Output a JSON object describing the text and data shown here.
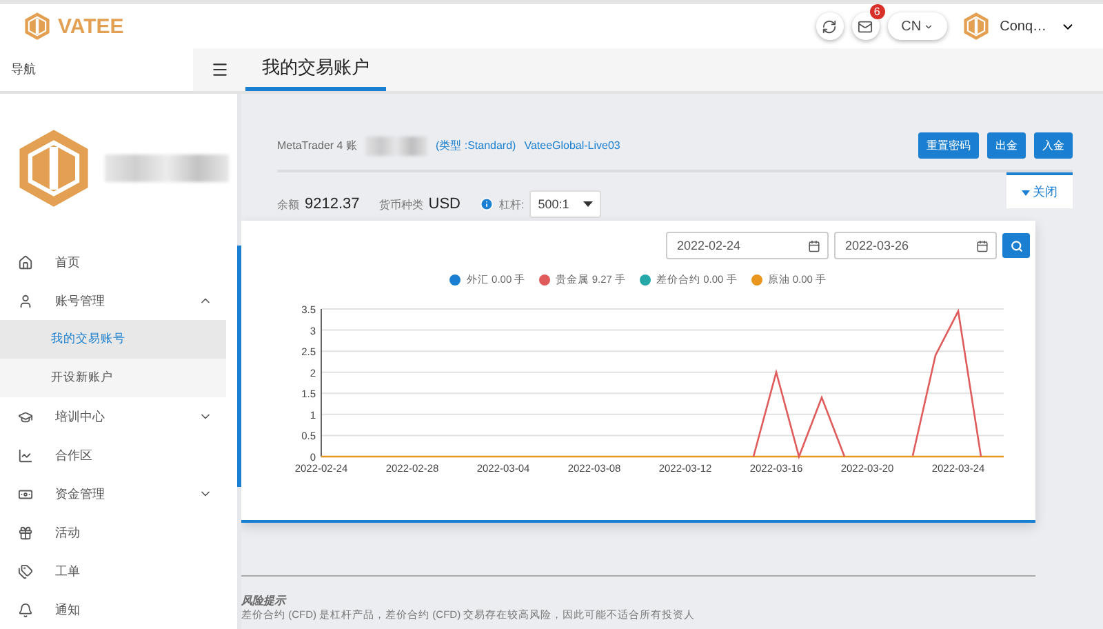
{
  "header": {
    "logo_text": "VATEE",
    "mail_badge": "6",
    "language": "CN",
    "user_name": "Conq…"
  },
  "nav": {
    "label": "导航",
    "tabs": [
      {
        "label": "我的交易账户",
        "selected": true
      }
    ]
  },
  "sidebar": {
    "items": [
      {
        "label": "首页"
      },
      {
        "label": "账号管理",
        "expanded": true,
        "children": [
          {
            "label": "我的交易账号",
            "selected": true
          },
          {
            "label": "开设新账户",
            "selected": false
          }
        ]
      },
      {
        "label": "培训中心",
        "expanded": false
      },
      {
        "label": "合作区"
      },
      {
        "label": "资金管理",
        "expanded": false
      },
      {
        "label": "活动"
      },
      {
        "label": "工单"
      },
      {
        "label": "通知"
      }
    ]
  },
  "account": {
    "platform": "MetaTrader 4 账",
    "type": "(类型 :Standard)",
    "server": "VateeGlobal-Live03",
    "buttons": [
      "重置密码",
      "出金",
      "入金"
    ]
  },
  "summary": {
    "balance_label": "余额",
    "balance": "9212.37",
    "currency_label": "货币种类",
    "currency": "USD",
    "leverage_label": "杠杆:",
    "leverage": "500:1"
  },
  "panel": {
    "toggle": "关闭",
    "date_from": "2022-02-24",
    "date_to": "2022-03-26",
    "legend": [
      {
        "label": "外汇 0.00 手",
        "color": "#1a7fd0"
      },
      {
        "label": "贵金属 9.27 手",
        "color": "#e05b5b"
      },
      {
        "label": "差价合约 0.00 手",
        "color": "#26a8a8"
      },
      {
        "label": "原油 0.00 手",
        "color": "#e8961e"
      }
    ],
    "chart_data": {
      "type": "line",
      "categories": [
        "2022-02-24",
        null,
        null,
        null,
        "2022-02-28",
        null,
        null,
        null,
        "2022-03-04",
        null,
        null,
        null,
        "2022-03-08",
        null,
        null,
        null,
        "2022-03-12",
        null,
        null,
        null,
        "2022-03-16",
        null,
        null,
        null,
        "2022-03-20",
        null,
        null,
        null,
        "2022-03-24",
        null,
        null
      ],
      "series": [
        {
          "color": "#e8961e",
          "values": [
            0,
            0,
            0,
            0,
            0,
            0,
            0,
            0,
            0,
            0,
            0,
            0,
            0,
            0,
            0,
            0,
            0,
            0,
            0,
            0,
            0,
            0,
            0,
            0,
            0,
            0,
            0,
            0,
            0,
            0,
            0
          ]
        },
        {
          "color": "#e05b5b",
          "values": [
            null,
            null,
            null,
            null,
            null,
            null,
            null,
            null,
            null,
            null,
            null,
            null,
            null,
            null,
            null,
            null,
            null,
            null,
            null,
            0,
            2,
            0,
            1.4,
            0,
            null,
            null,
            0.02,
            2.4,
            3.45,
            0,
            null
          ]
        }
      ],
      "grid": true,
      "ylim": [
        0,
        3.5
      ],
      "yticks": [
        0,
        0.5,
        1,
        1.5,
        2,
        2.5,
        3,
        3.5
      ]
    }
  },
  "risk": {
    "title": "风险提示",
    "text": "差价合约 (CFD) 是杠杆产品，差价合约 (CFD) 交易存在较高风险，因此可能不适合所有投资人"
  }
}
